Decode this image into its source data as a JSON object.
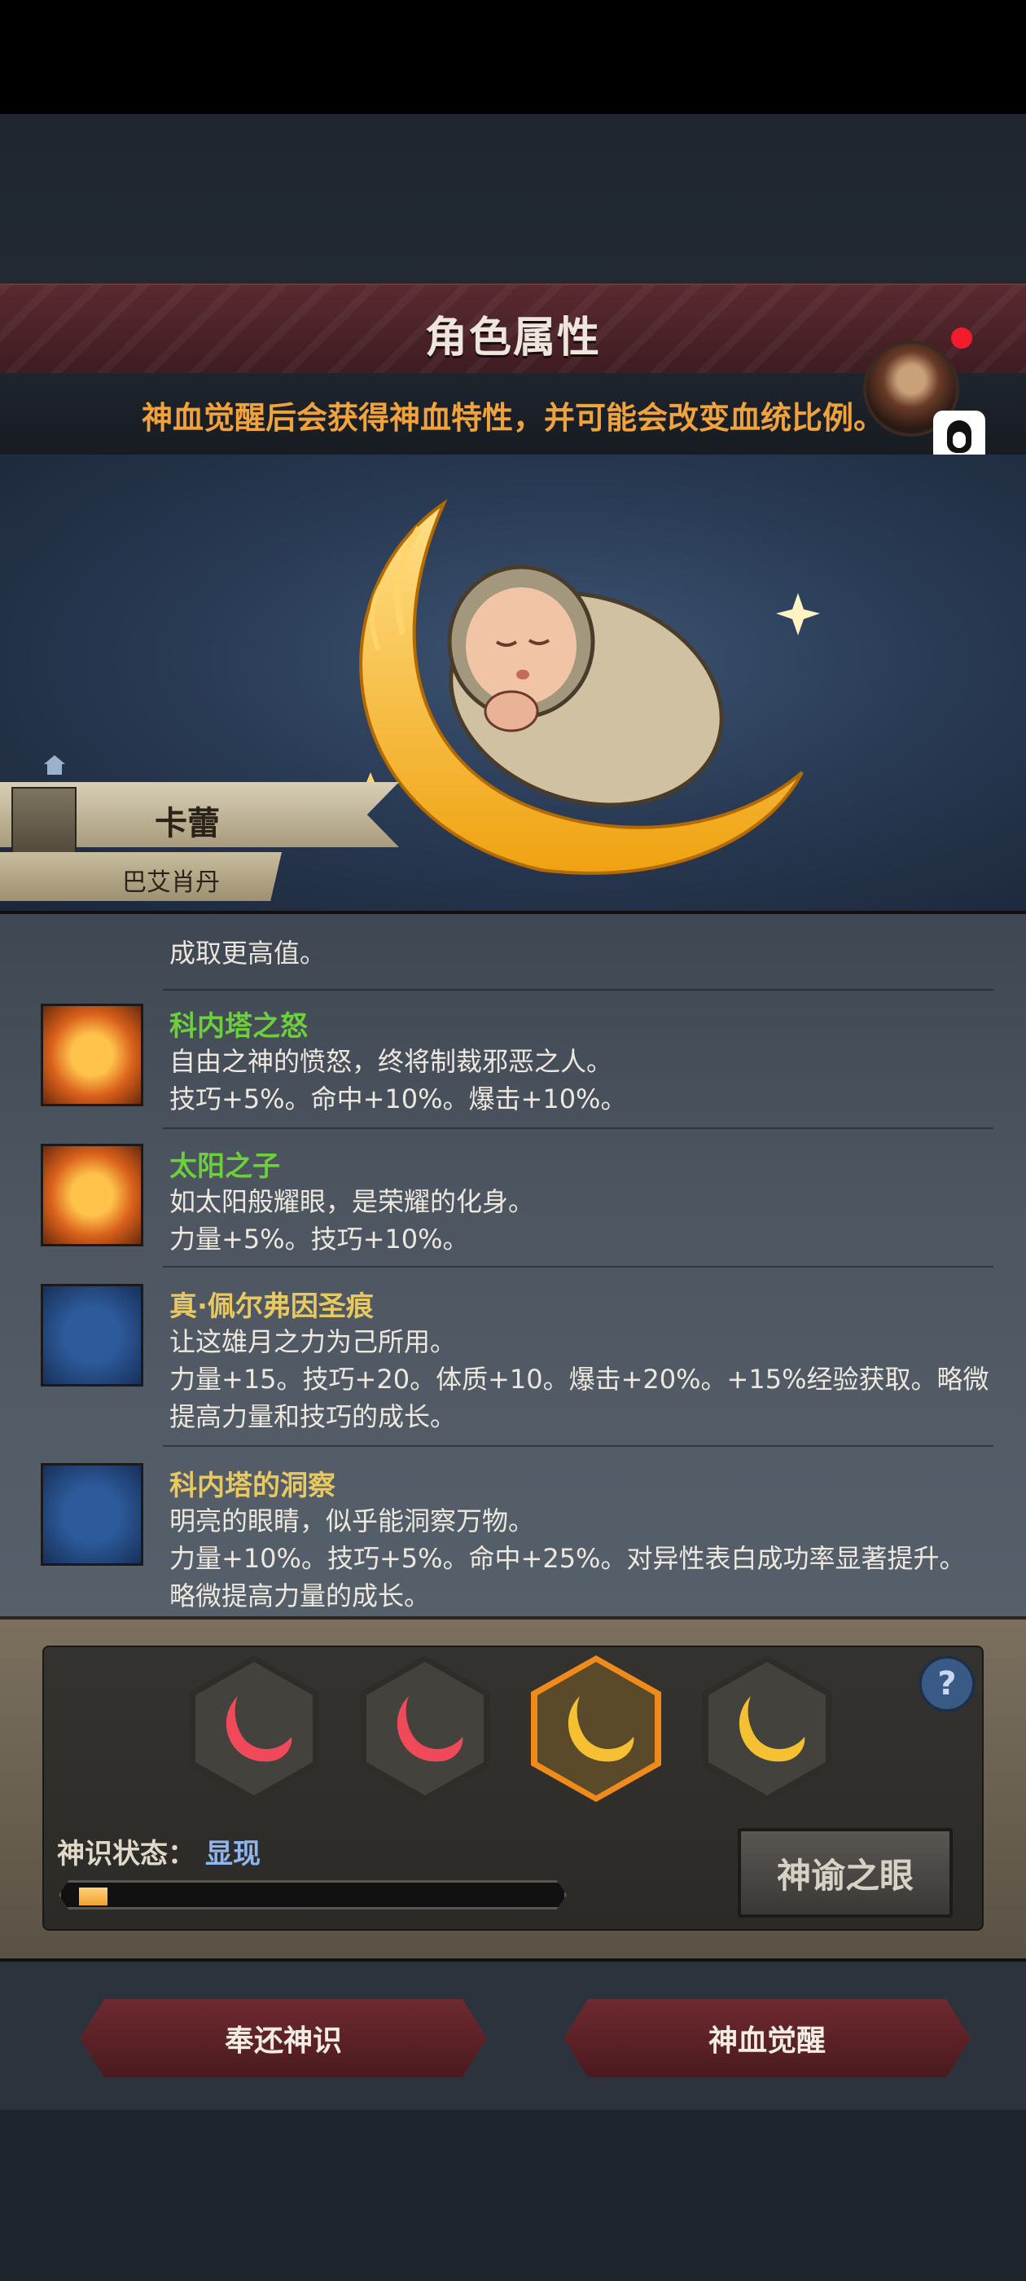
{
  "header": {
    "title": "角色属性",
    "hint": "神血觉醒后会获得神血特性，并可能会改变血统比例。"
  },
  "character": {
    "name": "卡蕾",
    "house": "巴艾肖丹"
  },
  "traits": {
    "partial_line": "成取更高值。",
    "items": [
      {
        "title": "科内塔之怒",
        "lines": [
          "自由之神的愤怒，终将制裁邪恶之人。",
          "技巧+5%。命中+10%。爆击+10%。"
        ]
      },
      {
        "title": "太阳之子",
        "lines": [
          "如太阳般耀眼，是荣耀的化身。",
          "力量+5%。技巧+10%。"
        ]
      },
      {
        "title": "真·佩尔弗因圣痕",
        "lines": [
          "让这雄月之力为己所用。",
          "力量+15。技巧+20。体质+10。爆击+20%。+15%经验获取。略微",
          "提高力量和技巧的成长。"
        ]
      },
      {
        "title": "科内塔的洞察",
        "lines": [
          "明亮的眼睛，似乎能洞察万物。",
          "力量+10%。技巧+5%。命中+25%。对异性表白成功率显著提升。",
          "略微提高力量的成长。"
        ]
      }
    ]
  },
  "panel": {
    "help": "?",
    "state_label": "神识状态：",
    "state_value": "显现",
    "progress": 0.06,
    "oracle_button": "神谕之眼"
  },
  "footer": {
    "return_button": "奉还神识",
    "awaken_button": "神血觉醒"
  }
}
